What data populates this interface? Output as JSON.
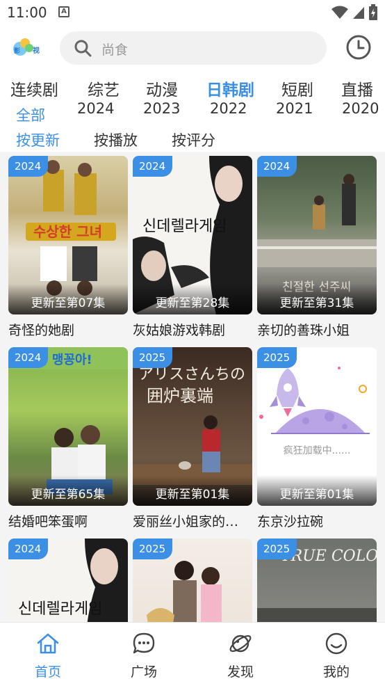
{
  "status_bar": {
    "time": "11:00",
    "notification_letter": "A"
  },
  "header": {
    "logo_text": "影视",
    "search_placeholder": "尚食"
  },
  "categories": [
    "连续剧",
    "综艺",
    "动漫",
    "日韩剧",
    "短剧",
    "直播"
  ],
  "active_category": 3,
  "years": [
    "全部",
    "2024",
    "2023",
    "2022",
    "2021",
    "2020"
  ],
  "sorts": [
    "按更新",
    "按播放",
    "按评分"
  ],
  "colors": {
    "accent": "#3b8fe5",
    "text": "#333333",
    "muted": "#999999",
    "grid_bg": "#f4f4f4"
  },
  "cards": [
    {
      "year": "2024",
      "episode": "更新至第07集",
      "title": "奇怪的她剧"
    },
    {
      "year": "2024",
      "episode": "更新至第28集",
      "title": "灰姑娘游戏韩剧"
    },
    {
      "year": "2024",
      "episode": "更新至第31集",
      "title": "亲切的善珠小姐"
    },
    {
      "year": "2024",
      "episode": "更新至第65集",
      "title": "结婚吧笨蛋啊"
    },
    {
      "year": "2025",
      "episode": "更新至第01集",
      "title": "爱丽丝小姐家的…"
    },
    {
      "year": "2025",
      "episode": "更新至第01集",
      "title": "东京沙拉碗",
      "loading": "疯狂加载中......"
    },
    {
      "year": "2024",
      "episode": "",
      "title": ""
    },
    {
      "year": "2025",
      "episode": "",
      "title": ""
    },
    {
      "year": "2025",
      "episode": "",
      "title": ""
    }
  ],
  "nav": [
    {
      "label": "首页",
      "icon": "home-icon"
    },
    {
      "label": "广场",
      "icon": "chat-icon"
    },
    {
      "label": "发现",
      "icon": "planet-icon"
    },
    {
      "label": "我的",
      "icon": "smile-icon"
    }
  ]
}
